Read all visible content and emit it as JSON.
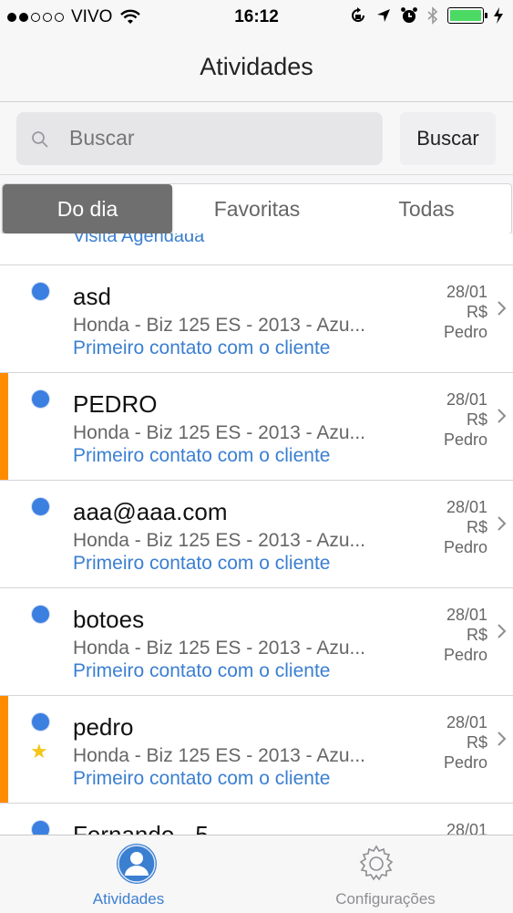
{
  "status_bar": {
    "carrier": "VIVO",
    "time": "16:12",
    "signal_filled": 2,
    "signal_total": 5,
    "battery_level": 1.0
  },
  "nav": {
    "title": "Atividades"
  },
  "search": {
    "placeholder": "Buscar",
    "button_label": "Buscar"
  },
  "segments": {
    "items": [
      "Do dia",
      "Favoritas",
      "Todas"
    ],
    "selected": "Do dia"
  },
  "partial_row": {
    "status": "Visita Agendada"
  },
  "rows": [
    {
      "name": "asd",
      "desc": "Honda - Biz 125 ES - 2013 - Azu...",
      "status": "Primeiro contato com o cliente",
      "date": "28/01",
      "price": "R$",
      "owner": "Pedro",
      "highlight": false,
      "favorite": false
    },
    {
      "name": "PEDRO",
      "desc": "Honda - Biz 125 ES - 2013 - Azu...",
      "status": "Primeiro contato com o cliente",
      "date": "28/01",
      "price": "R$",
      "owner": "Pedro",
      "highlight": true,
      "favorite": false
    },
    {
      "name": "aaa@aaa.com",
      "desc": "Honda - Biz 125 ES - 2013 - Azu...",
      "status": "Primeiro contato com o cliente",
      "date": "28/01",
      "price": "R$",
      "owner": "Pedro",
      "highlight": false,
      "favorite": false
    },
    {
      "name": "botoes",
      "desc": "Honda - Biz 125 ES - 2013 - Azu...",
      "status": "Primeiro contato com o cliente",
      "date": "28/01",
      "price": "R$",
      "owner": "Pedro",
      "highlight": false,
      "favorite": false
    },
    {
      "name": "pedro",
      "desc": "Honda - Biz 125 ES - 2013 - Azu...",
      "status": "Primeiro contato com o cliente",
      "date": "28/01",
      "price": "R$",
      "owner": "Pedro",
      "highlight": true,
      "favorite": true
    },
    {
      "name": "Fernando - 5",
      "desc": "",
      "status": "",
      "date": "28/01",
      "price": "",
      "owner": "",
      "highlight": false,
      "favorite": false
    }
  ],
  "tabbar": {
    "items": [
      {
        "label": "Atividades",
        "icon": "person-icon",
        "active": true
      },
      {
        "label": "Configurações",
        "icon": "gear-icon",
        "active": false
      }
    ]
  },
  "colors": {
    "accent": "#3b7fd1",
    "highlight_stripe": "#ff8c00",
    "unread_dot": "#3b7fe0",
    "favorite_star": "#f5c518",
    "segment_selected": "#6f6f70",
    "battery": "#4cd964"
  }
}
